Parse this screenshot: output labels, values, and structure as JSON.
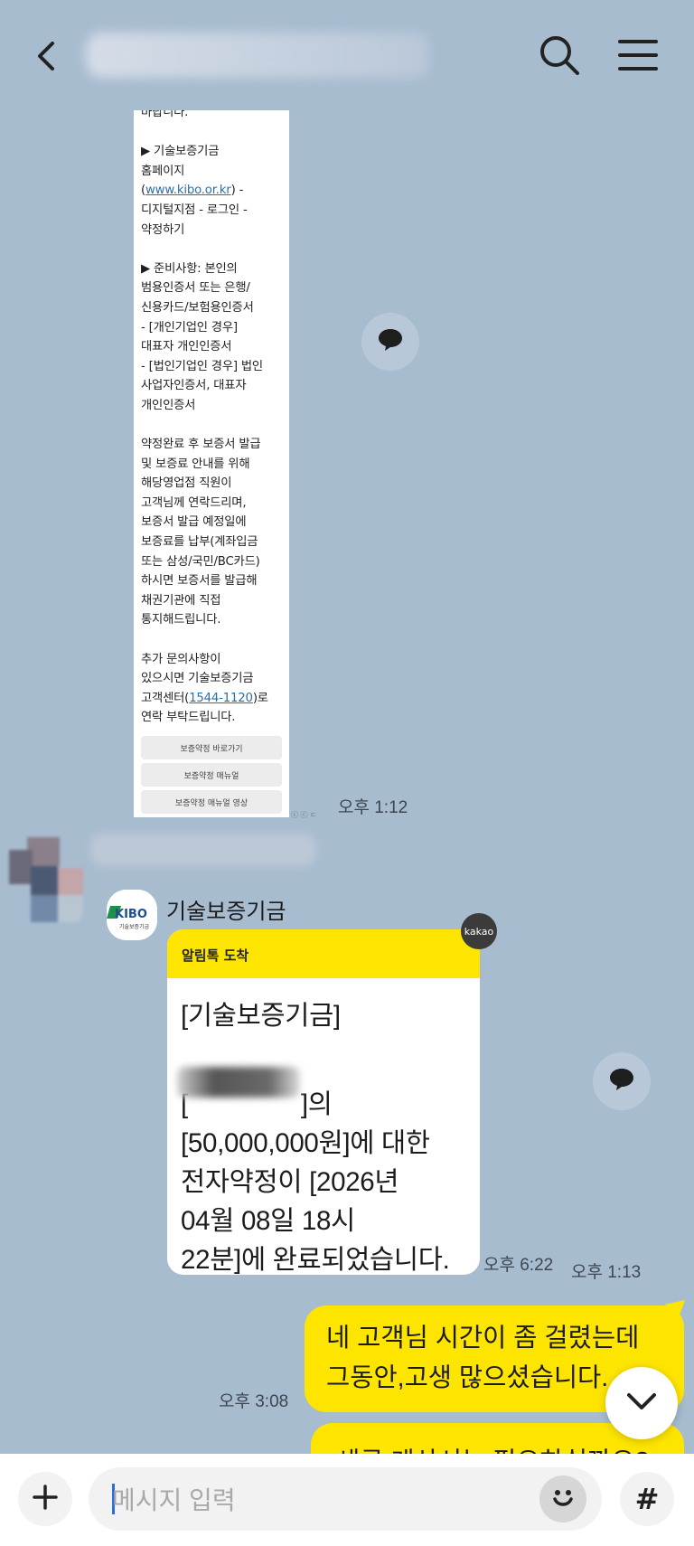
{
  "header": {
    "back_icon": "chevron-left-icon",
    "search_icon": "search-icon",
    "menu_icon": "hamburger-menu-icon"
  },
  "image_message": {
    "text_before_link1": "바랍니다.\n\n▶ 기술보증기금\n홈페이지\n(",
    "link1": "www.kibo.or.kr",
    "text_after_link1": ") -\n디지털지점 - 로그인 -\n약정하기\n\n▶ 준비사항: 본인의\n범용인증서 또는 은행/\n신용카드/보험용인증서\n- [개인기업인 경우]\n대표자 개인인증서\n- [법인기업인 경우] 법인\n사업자인증서, 대표자\n개인인증서\n\n약정완료 후 보증서 발급\n및 보증료 안내를 위해\n해당영업점 직원이\n고객님께 연락드리며,\n보증서 발급 예정일에\n보증료를 납부(계좌입금\n또는 삼성/국민/BC카드)\n하시면 보증서를 발급해\n채권기관에 직접\n통지해드립니다.\n\n추가 문의사항이\n있으시면 기술보증기금\n고객센터(",
    "link2": "1544-1120",
    "text_after_link2": ")로\n연락 부탁드립니다.",
    "buttons": [
      "보증약정 바로가기",
      "보증약정 매뉴얼",
      "보증약정 매뉴얼 영상"
    ],
    "time": "오후 1:12",
    "tiny_text": "ⓒ ⓒ ㄷ"
  },
  "alimtalk": {
    "sender_name": "기술보증기금",
    "logo_text": "KIBO",
    "logo_sub": "기술보증기금",
    "badge": "kakao",
    "header": "알림톡 도착",
    "title": "[기술보증기금]",
    "body_line1_suffix": "]의",
    "body_rest": "[50,000,000원]에 대한\n전자약정이 [2026년\n04월 08일 18시\n22분]에 완료되었습니다.",
    "time_inner": "오후 6:22",
    "time_outer": "오후 1:13"
  },
  "my_messages": [
    {
      "text": "네 고객님 시간이 좀 걸렸는데\n그동안,고생 많으셨습니다.",
      "time": "오후 3:08"
    },
    {
      "text": "세금 계산서는 필요하실까요?"
    }
  ],
  "input": {
    "placeholder": "메시지 입력",
    "plus_icon": "plus-icon",
    "emoji_icon": "emoji-icon",
    "hash_icon": "#"
  }
}
